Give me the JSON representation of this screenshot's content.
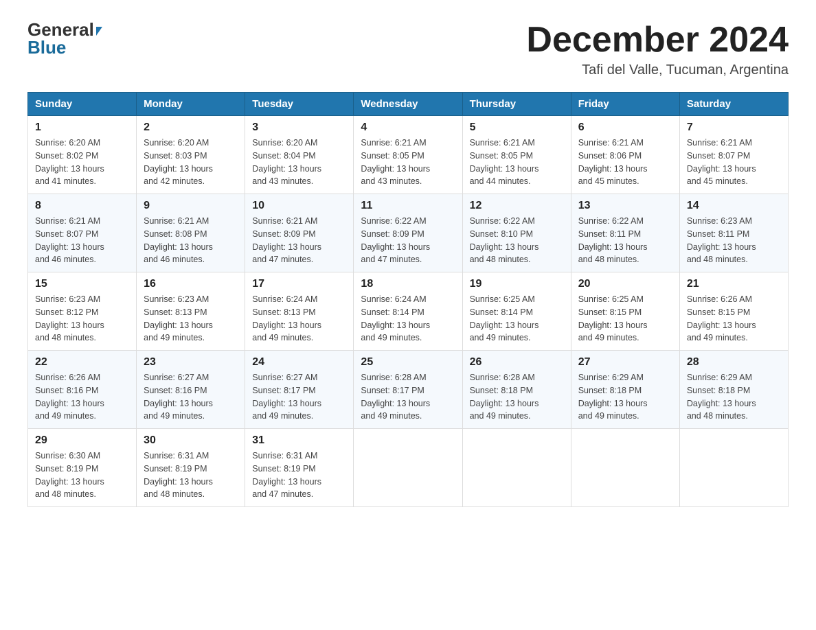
{
  "header": {
    "logo_general": "General",
    "logo_blue": "Blue",
    "month_title": "December 2024",
    "subtitle": "Tafi del Valle, Tucuman, Argentina"
  },
  "days_of_week": [
    "Sunday",
    "Monday",
    "Tuesday",
    "Wednesday",
    "Thursday",
    "Friday",
    "Saturday"
  ],
  "weeks": [
    [
      {
        "day": "1",
        "sunrise": "6:20 AM",
        "sunset": "8:02 PM",
        "daylight": "13 hours and 41 minutes."
      },
      {
        "day": "2",
        "sunrise": "6:20 AM",
        "sunset": "8:03 PM",
        "daylight": "13 hours and 42 minutes."
      },
      {
        "day": "3",
        "sunrise": "6:20 AM",
        "sunset": "8:04 PM",
        "daylight": "13 hours and 43 minutes."
      },
      {
        "day": "4",
        "sunrise": "6:21 AM",
        "sunset": "8:05 PM",
        "daylight": "13 hours and 43 minutes."
      },
      {
        "day": "5",
        "sunrise": "6:21 AM",
        "sunset": "8:05 PM",
        "daylight": "13 hours and 44 minutes."
      },
      {
        "day": "6",
        "sunrise": "6:21 AM",
        "sunset": "8:06 PM",
        "daylight": "13 hours and 45 minutes."
      },
      {
        "day": "7",
        "sunrise": "6:21 AM",
        "sunset": "8:07 PM",
        "daylight": "13 hours and 45 minutes."
      }
    ],
    [
      {
        "day": "8",
        "sunrise": "6:21 AM",
        "sunset": "8:07 PM",
        "daylight": "13 hours and 46 minutes."
      },
      {
        "day": "9",
        "sunrise": "6:21 AM",
        "sunset": "8:08 PM",
        "daylight": "13 hours and 46 minutes."
      },
      {
        "day": "10",
        "sunrise": "6:21 AM",
        "sunset": "8:09 PM",
        "daylight": "13 hours and 47 minutes."
      },
      {
        "day": "11",
        "sunrise": "6:22 AM",
        "sunset": "8:09 PM",
        "daylight": "13 hours and 47 minutes."
      },
      {
        "day": "12",
        "sunrise": "6:22 AM",
        "sunset": "8:10 PM",
        "daylight": "13 hours and 48 minutes."
      },
      {
        "day": "13",
        "sunrise": "6:22 AM",
        "sunset": "8:11 PM",
        "daylight": "13 hours and 48 minutes."
      },
      {
        "day": "14",
        "sunrise": "6:23 AM",
        "sunset": "8:11 PM",
        "daylight": "13 hours and 48 minutes."
      }
    ],
    [
      {
        "day": "15",
        "sunrise": "6:23 AM",
        "sunset": "8:12 PM",
        "daylight": "13 hours and 48 minutes."
      },
      {
        "day": "16",
        "sunrise": "6:23 AM",
        "sunset": "8:13 PM",
        "daylight": "13 hours and 49 minutes."
      },
      {
        "day": "17",
        "sunrise": "6:24 AM",
        "sunset": "8:13 PM",
        "daylight": "13 hours and 49 minutes."
      },
      {
        "day": "18",
        "sunrise": "6:24 AM",
        "sunset": "8:14 PM",
        "daylight": "13 hours and 49 minutes."
      },
      {
        "day": "19",
        "sunrise": "6:25 AM",
        "sunset": "8:14 PM",
        "daylight": "13 hours and 49 minutes."
      },
      {
        "day": "20",
        "sunrise": "6:25 AM",
        "sunset": "8:15 PM",
        "daylight": "13 hours and 49 minutes."
      },
      {
        "day": "21",
        "sunrise": "6:26 AM",
        "sunset": "8:15 PM",
        "daylight": "13 hours and 49 minutes."
      }
    ],
    [
      {
        "day": "22",
        "sunrise": "6:26 AM",
        "sunset": "8:16 PM",
        "daylight": "13 hours and 49 minutes."
      },
      {
        "day": "23",
        "sunrise": "6:27 AM",
        "sunset": "8:16 PM",
        "daylight": "13 hours and 49 minutes."
      },
      {
        "day": "24",
        "sunrise": "6:27 AM",
        "sunset": "8:17 PM",
        "daylight": "13 hours and 49 minutes."
      },
      {
        "day": "25",
        "sunrise": "6:28 AM",
        "sunset": "8:17 PM",
        "daylight": "13 hours and 49 minutes."
      },
      {
        "day": "26",
        "sunrise": "6:28 AM",
        "sunset": "8:18 PM",
        "daylight": "13 hours and 49 minutes."
      },
      {
        "day": "27",
        "sunrise": "6:29 AM",
        "sunset": "8:18 PM",
        "daylight": "13 hours and 49 minutes."
      },
      {
        "day": "28",
        "sunrise": "6:29 AM",
        "sunset": "8:18 PM",
        "daylight": "13 hours and 48 minutes."
      }
    ],
    [
      {
        "day": "29",
        "sunrise": "6:30 AM",
        "sunset": "8:19 PM",
        "daylight": "13 hours and 48 minutes."
      },
      {
        "day": "30",
        "sunrise": "6:31 AM",
        "sunset": "8:19 PM",
        "daylight": "13 hours and 48 minutes."
      },
      {
        "day": "31",
        "sunrise": "6:31 AM",
        "sunset": "8:19 PM",
        "daylight": "13 hours and 47 minutes."
      },
      null,
      null,
      null,
      null
    ]
  ],
  "labels": {
    "sunrise": "Sunrise:",
    "sunset": "Sunset:",
    "daylight": "Daylight:"
  }
}
